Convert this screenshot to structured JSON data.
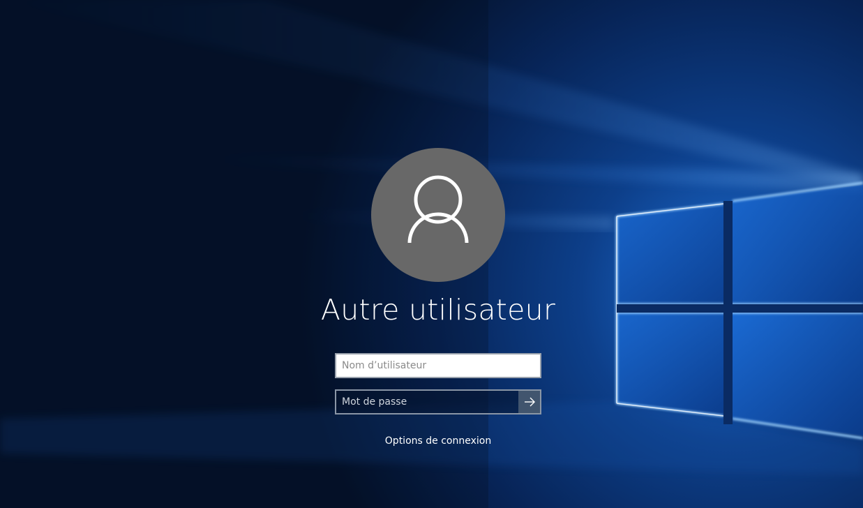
{
  "login": {
    "user_name": "Autre utilisateur",
    "username_placeholder": "Nom d’utilisateur",
    "username_value": "",
    "password_placeholder": "Mot de passe",
    "password_value": "",
    "submit_icon": "arrow-right-icon",
    "sign_in_options_label": "Options de connexion",
    "avatar_icon": "person-icon"
  },
  "colors": {
    "background": "#061a3a",
    "avatar": "#686868",
    "accent_light": "#3a9bff",
    "submit_button": "#41556e"
  }
}
